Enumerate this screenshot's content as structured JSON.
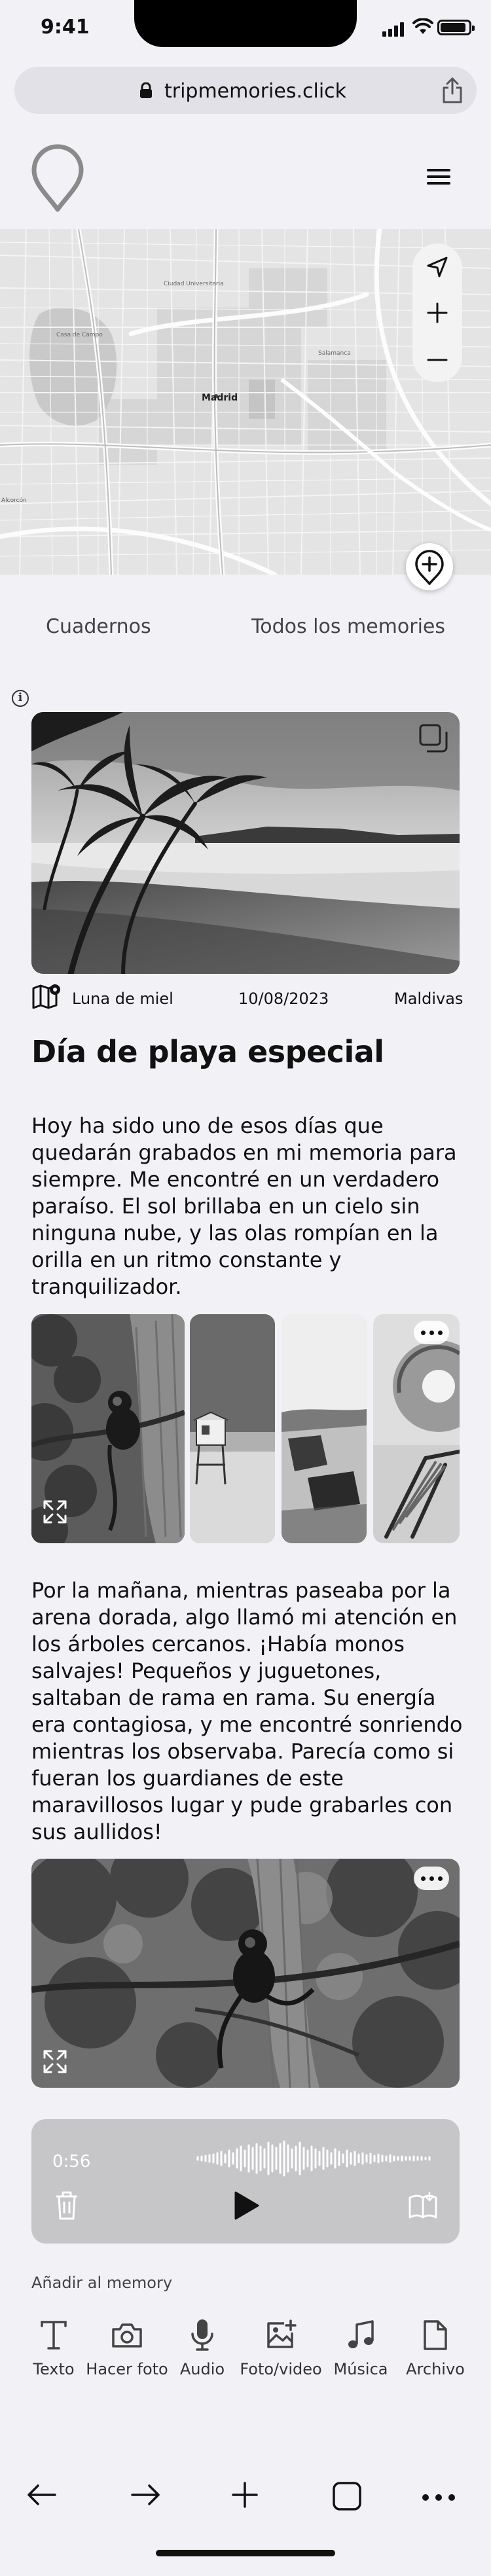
{
  "status": {
    "time": "9:41"
  },
  "browser": {
    "url": "tripmemories.click",
    "lock_icon": "lock-icon",
    "share_icon": "share-icon"
  },
  "header": {
    "logo_icon": "location-pin-logo",
    "menu_icon": "hamburger-menu-icon"
  },
  "map": {
    "city_label": "Madrid",
    "controls": [
      "navigation-arrow-icon",
      "zoom-in-icon",
      "zoom-out-icon"
    ],
    "add_button_icon": "add-location-icon"
  },
  "tabs": [
    {
      "label": "Cuadernos"
    },
    {
      "label": "Todos los memories"
    }
  ],
  "memory": {
    "notebook": "Luna de miel",
    "date": "10/08/2023",
    "place": "Maldivas",
    "title": "Día de playa especial",
    "paragraph1": "Hoy ha sido uno de esos días que quedarán grabados en mi memoria para siempre. Me encontré en un verdadero paraíso. El sol brillaba en un cielo sin ninguna nube, y las olas rompían en la orilla en un ritmo constante y tranquilizador.",
    "paragraph2": "Por la mañana, mientras paseaba por la arena dorada, algo llamó mi atención en los árboles cercanos. ¡Había monos salvajes! Pequeños y juguetones, saltaban de rama en rama. Su energía era contagiosa, y me encontré sonriendo mientras los observaba. Parecía como si fueran los guardianes de este maravillosos lugar y pude grabarles con sus aullidos!"
  },
  "audio": {
    "elapsed": "0:56"
  },
  "add_section": {
    "label": "Añadir al memory",
    "tools": [
      {
        "label": "Texto",
        "icon": "text-icon"
      },
      {
        "label": "Hacer foto",
        "icon": "camera-icon"
      },
      {
        "label": "Audio",
        "icon": "microphone-icon"
      },
      {
        "label": "Foto/video",
        "icon": "add-image-icon"
      },
      {
        "label": "Música",
        "icon": "music-note-icon"
      },
      {
        "label": "Archivo",
        "icon": "file-icon"
      }
    ]
  },
  "bottom_nav": [
    "back-arrow-icon",
    "forward-arrow-icon",
    "new-tab-icon",
    "tabs-icon",
    "more-icon"
  ]
}
